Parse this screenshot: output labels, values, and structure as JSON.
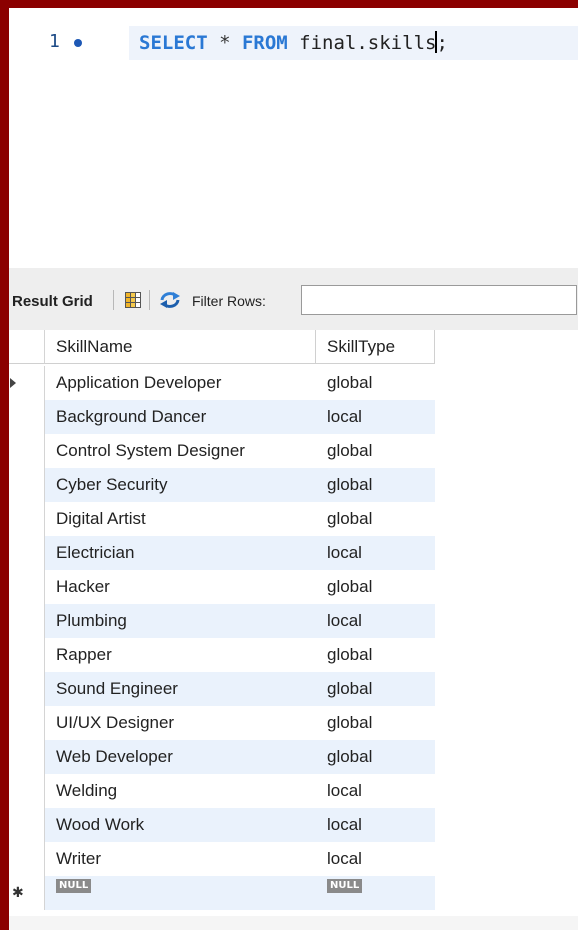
{
  "editor": {
    "line_number": "1",
    "code": {
      "kw_select": "SELECT",
      "star": " * ",
      "kw_from": "FROM",
      "table_before_cursor": " final.skills",
      "table_after_cursor": ";"
    }
  },
  "toolbar": {
    "result_grid_label": "Result Grid",
    "filter_label": "Filter Rows:",
    "filter_value": ""
  },
  "grid": {
    "columns": [
      "SkillName",
      "SkillType"
    ],
    "rows": [
      {
        "name": "Application Developer",
        "type": "global"
      },
      {
        "name": "Background Dancer",
        "type": "local"
      },
      {
        "name": "Control System Designer",
        "type": "global"
      },
      {
        "name": "Cyber Security",
        "type": "global"
      },
      {
        "name": "Digital Artist",
        "type": "global"
      },
      {
        "name": "Electrician",
        "type": "local"
      },
      {
        "name": "Hacker",
        "type": "global"
      },
      {
        "name": "Plumbing",
        "type": "local"
      },
      {
        "name": "Rapper",
        "type": "global"
      },
      {
        "name": "Sound Engineer",
        "type": "global"
      },
      {
        "name": "UI/UX Designer",
        "type": "global"
      },
      {
        "name": "Web Developer",
        "type": "global"
      },
      {
        "name": "Welding",
        "type": "local"
      },
      {
        "name": "Wood Work",
        "type": "local"
      },
      {
        "name": "Writer",
        "type": "local"
      }
    ],
    "null_label": "NULL"
  },
  "colors": {
    "frame": "#8b0000",
    "keyword": "#2a78d4",
    "alt_row": "#eaf2fc"
  }
}
